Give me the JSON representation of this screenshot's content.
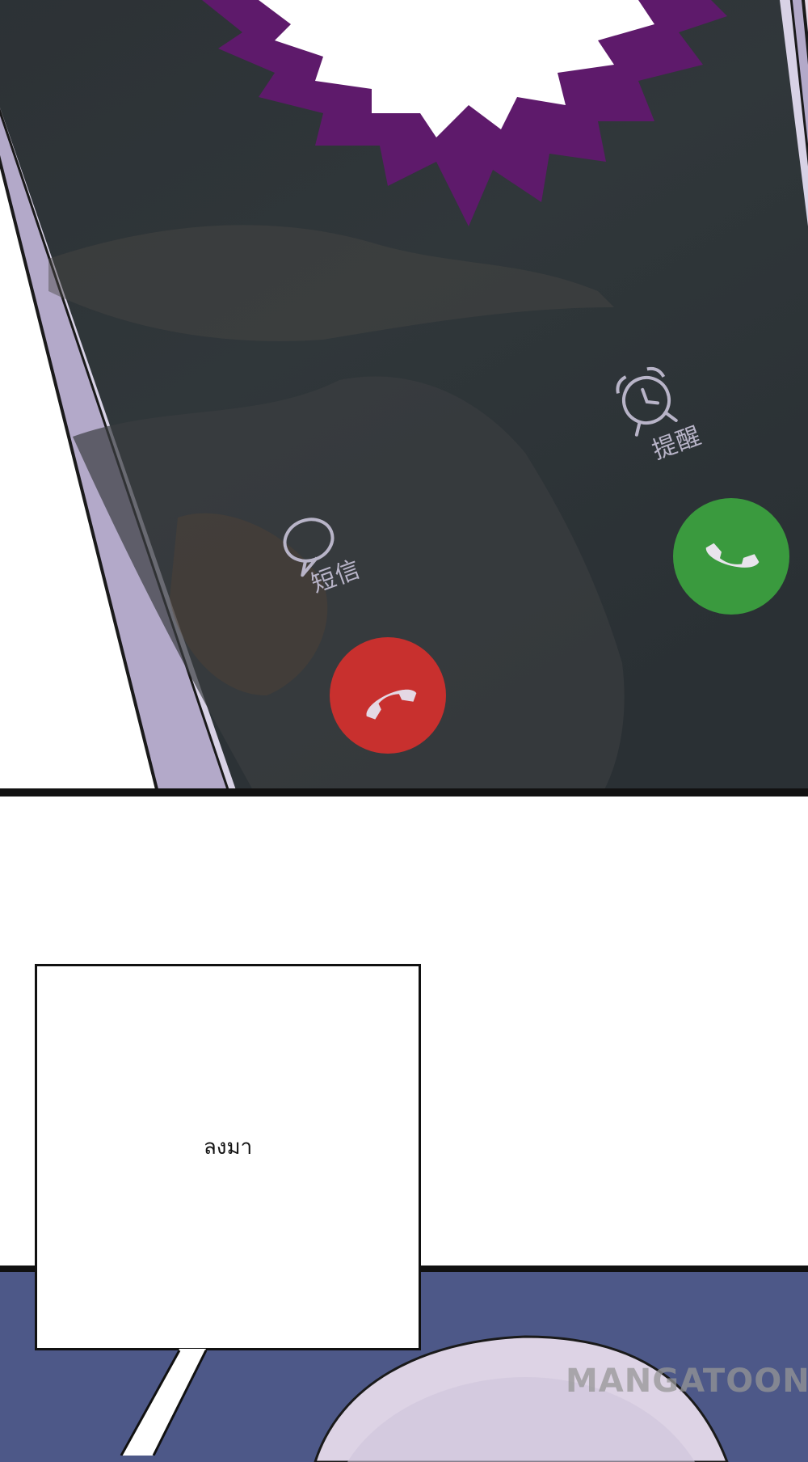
{
  "call_screen": {
    "sms_label": "短信",
    "remind_label": "提醒",
    "icons": [
      "chat-bubble-icon",
      "alarm-clock-icon",
      "phone-decline-icon",
      "phone-answer-icon"
    ],
    "colors": {
      "decline": "#c8302e",
      "answer": "#3a9a3e",
      "screen": "#2c3136",
      "burst": "#5e1a6b"
    }
  },
  "speech_bubble": {
    "text": "ลงมา"
  },
  "watermark": {
    "text": "MANGATOON"
  }
}
